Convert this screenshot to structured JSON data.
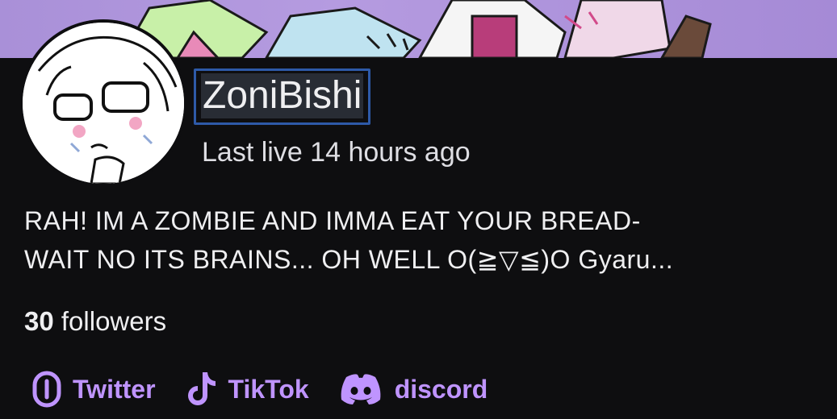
{
  "channel": {
    "name": "ZoniBishi",
    "last_live": "Last live 14 hours ago",
    "bio_line1": "RAH! IM A ZOMBIE AND IMMA EAT YOUR BREAD-",
    "bio_line2": "WAIT NO ITS BRAINS... OH WELL O(≧▽≦)O Gyaru...",
    "followers_count": "30",
    "followers_label": "followers"
  },
  "socials": [
    {
      "label": "Twitter",
      "icon": "twitter-link-icon"
    },
    {
      "label": "TikTok",
      "icon": "tiktok-icon"
    },
    {
      "label": "discord",
      "icon": "discord-icon"
    }
  ],
  "colors": {
    "background": "#0e0e10",
    "accent": "#bf94ff",
    "banner": "#b59be0",
    "name_box_border": "#2e5aa8"
  }
}
